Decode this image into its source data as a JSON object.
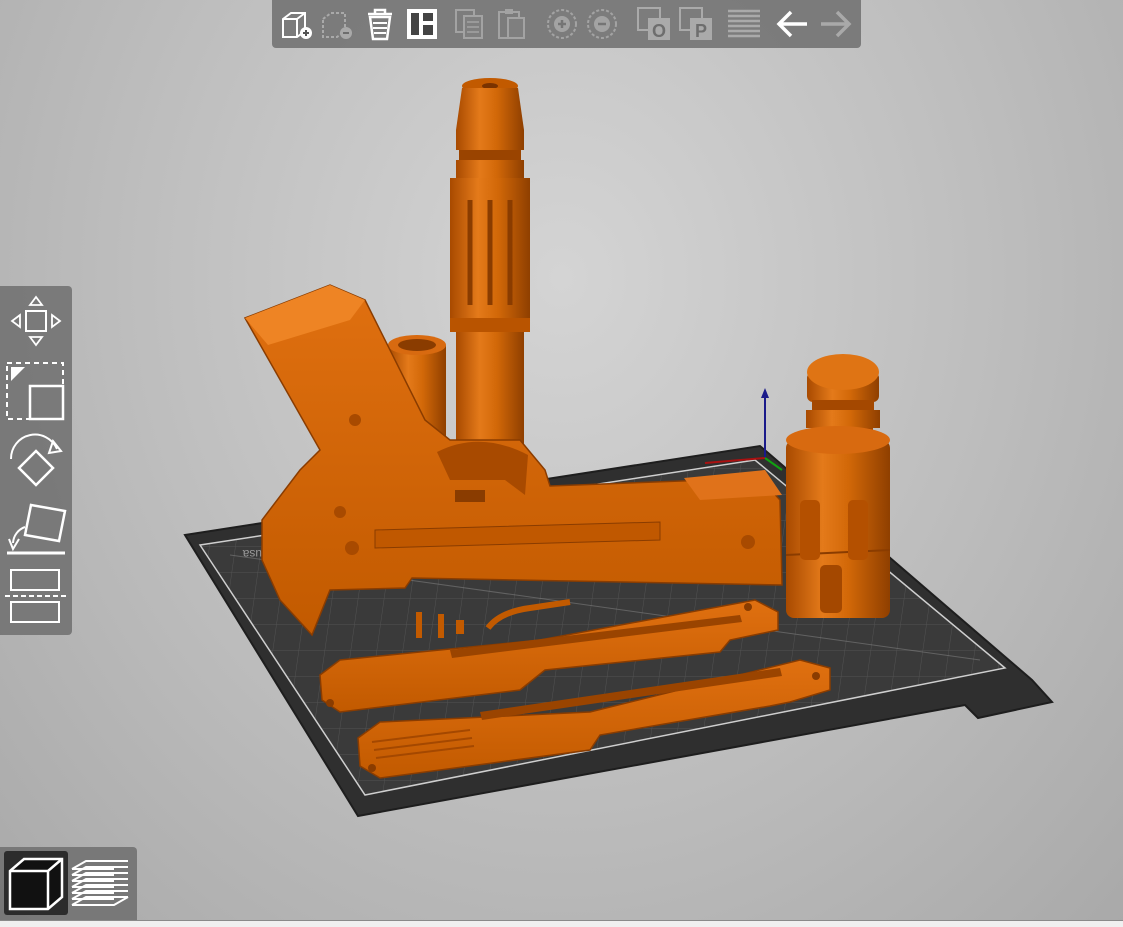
{
  "app": {
    "accent_color": "#E06A00",
    "model_color": "#D06000",
    "bed_color": "#2F2F2F"
  },
  "top_toolbar": {
    "buttons": [
      {
        "id": "add",
        "icon": "add-object-icon",
        "enabled": true
      },
      {
        "id": "delete",
        "icon": "remove-object-icon",
        "enabled": false
      },
      {
        "id": "delete_all",
        "icon": "trash-icon",
        "enabled": true
      },
      {
        "id": "arrange",
        "icon": "arrange-icon",
        "enabled": true
      },
      {
        "id": "copy",
        "icon": "copy-icon",
        "enabled": false
      },
      {
        "id": "paste",
        "icon": "paste-icon",
        "enabled": false
      },
      {
        "id": "add_instance",
        "icon": "plus-circle-icon",
        "enabled": false
      },
      {
        "id": "remove_instance",
        "icon": "minus-circle-icon",
        "enabled": false
      },
      {
        "id": "split_objects",
        "icon": "split-objects-icon",
        "label": "O",
        "enabled": false
      },
      {
        "id": "split_parts",
        "icon": "split-parts-icon",
        "label": "P",
        "enabled": false
      },
      {
        "id": "layers_editing",
        "icon": "layers-icon",
        "enabled": false
      },
      {
        "id": "undo",
        "icon": "undo-arrow-icon",
        "enabled": true
      },
      {
        "id": "redo",
        "icon": "redo-arrow-icon",
        "enabled": false
      }
    ]
  },
  "left_toolbar": {
    "tools": [
      {
        "id": "move",
        "icon": "move-icon"
      },
      {
        "id": "scale",
        "icon": "scale-icon"
      },
      {
        "id": "rotate",
        "icon": "rotate-icon"
      },
      {
        "id": "place_on_face",
        "icon": "place-on-face-icon"
      },
      {
        "id": "cut",
        "icon": "cut-icon"
      }
    ]
  },
  "view_toggle": {
    "buttons": [
      {
        "id": "3d_view",
        "icon": "3d-cube-icon",
        "active": true
      },
      {
        "id": "preview",
        "icon": "layers-stack-icon",
        "active": false
      }
    ]
  },
  "bed": {
    "label": "usa"
  }
}
